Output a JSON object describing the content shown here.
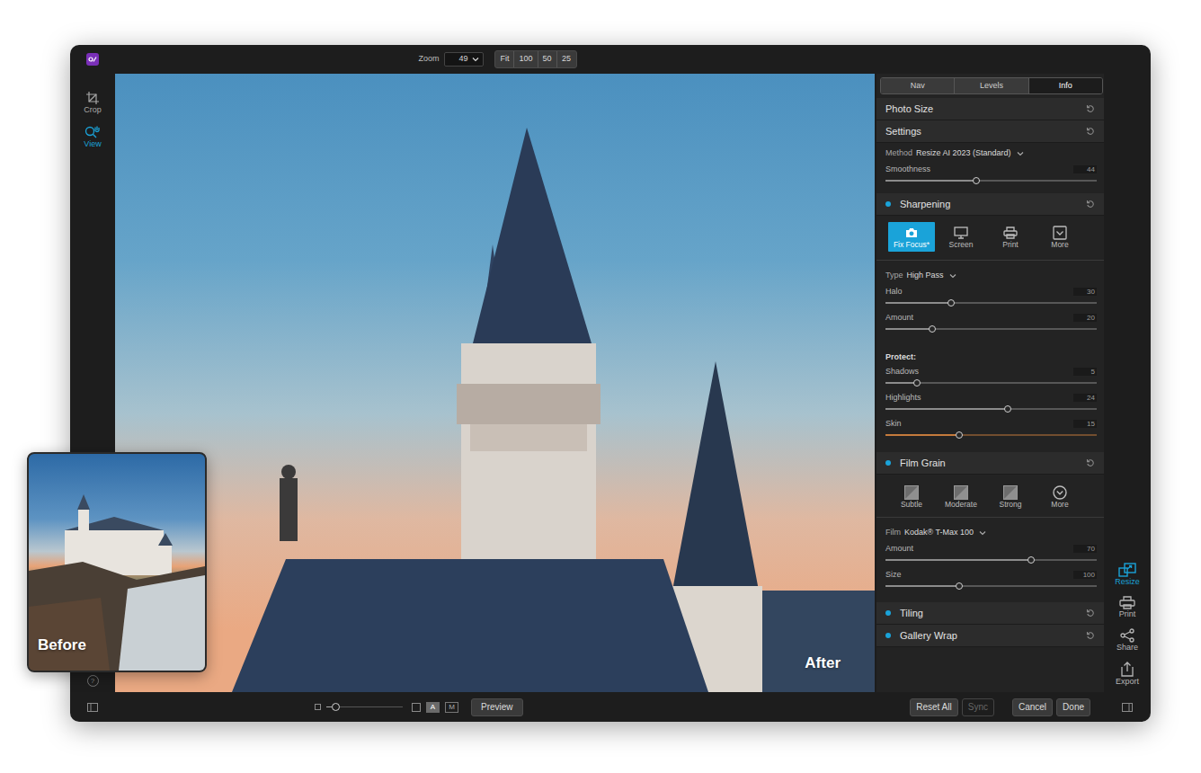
{
  "topbar": {
    "zoom_label": "Zoom",
    "zoom_value": "49",
    "zoom_presets": [
      {
        "label": "Fit",
        "selected": false
      },
      {
        "label": "100",
        "selected": false
      },
      {
        "label": "50",
        "selected": false
      },
      {
        "label": "25",
        "selected": false
      }
    ]
  },
  "tools": [
    {
      "label": "Crop",
      "kind": "crop",
      "selected": false
    },
    {
      "label": "View",
      "kind": "view",
      "selected": true
    }
  ],
  "help_label": "?",
  "photo": {
    "after_label": "After"
  },
  "before_inset": {
    "label": "Before"
  },
  "panel_tabs": [
    {
      "label": "Nav",
      "selected": false
    },
    {
      "label": "Levels",
      "selected": false
    },
    {
      "label": "Info",
      "selected": true
    }
  ],
  "sections": [
    {
      "title": "Photo Size",
      "enabled": false,
      "controls": []
    },
    {
      "title": "Settings",
      "enabled": false,
      "controls": [
        {
          "kind": "dropdown",
          "label": "Method",
          "value": "Resize AI 2023 (Standard)"
        },
        {
          "kind": "slider",
          "label": "Smoothness",
          "value": "44",
          "level": 0.43,
          "color": "#8c8c8c"
        }
      ]
    },
    {
      "title": "Sharpening",
      "enabled": true,
      "controls": [
        {
          "kind": "presets",
          "items": [
            {
              "label": "Fix Focus*",
              "kind": "camera",
              "selected": true
            },
            {
              "label": "Screen",
              "kind": "monitor",
              "selected": false
            },
            {
              "label": "Print",
              "kind": "printer",
              "selected": false
            },
            {
              "label": "More",
              "kind": "more-square",
              "selected": false
            }
          ]
        },
        {
          "kind": "dropdown",
          "label": "Type",
          "value": "High Pass"
        },
        {
          "kind": "slider",
          "label": "Halo",
          "value": "30",
          "level": 0.31,
          "color": "#8c8c8c"
        },
        {
          "kind": "slider",
          "label": "Amount",
          "value": "20",
          "level": 0.22,
          "color": "#8c8c8c"
        },
        {
          "kind": "heading",
          "label": "Protect:"
        },
        {
          "kind": "slider",
          "label": "Shadows",
          "value": "5",
          "level": 0.15,
          "color": "#8c8c8c"
        },
        {
          "kind": "slider",
          "label": "Highlights",
          "value": "24",
          "level": 0.58,
          "color": "#8c8c8c"
        },
        {
          "kind": "slider",
          "label": "Skin",
          "value": "15",
          "level": 0.35,
          "color": "#c47a3c"
        }
      ]
    },
    {
      "title": "Film Grain",
      "enabled": true,
      "controls": [
        {
          "kind": "presets",
          "items": [
            {
              "label": "Subtle",
              "kind": "grain",
              "selected": false
            },
            {
              "label": "Moderate",
              "kind": "grain",
              "selected": false
            },
            {
              "label": "Strong",
              "kind": "grain",
              "selected": false
            },
            {
              "label": "More",
              "kind": "more-circle",
              "selected": false
            }
          ]
        },
        {
          "kind": "dropdown",
          "label": "Film",
          "value": "Kodak® T-Max 100"
        },
        {
          "kind": "slider",
          "label": "Amount",
          "value": "70",
          "level": 0.69,
          "color": "#8c8c8c"
        },
        {
          "kind": "slider",
          "label": "Size",
          "value": "100",
          "level": 0.35,
          "color": "#8c8c8c"
        }
      ]
    },
    {
      "title": "Tiling",
      "enabled": true,
      "controls": []
    },
    {
      "title": "Gallery Wrap",
      "enabled": true,
      "controls": []
    }
  ],
  "modules": [
    {
      "label": "Resize",
      "kind": "resize",
      "selected": true
    },
    {
      "label": "Print",
      "kind": "print",
      "selected": false
    },
    {
      "label": "Share",
      "kind": "share",
      "selected": false
    },
    {
      "label": "Export",
      "kind": "export",
      "selected": false
    }
  ],
  "bottom": {
    "thumb_size_level": 0.12,
    "view_modes": [
      {
        "label": "A",
        "selected": true
      },
      {
        "label": "M",
        "selected": false
      }
    ],
    "preview_label": "Preview",
    "buttons": [
      {
        "label": "Reset All",
        "disabled": false
      },
      {
        "label": "Sync",
        "disabled": true
      },
      {
        "label": "Cancel",
        "disabled": false
      },
      {
        "label": "Done",
        "disabled": false
      }
    ]
  }
}
